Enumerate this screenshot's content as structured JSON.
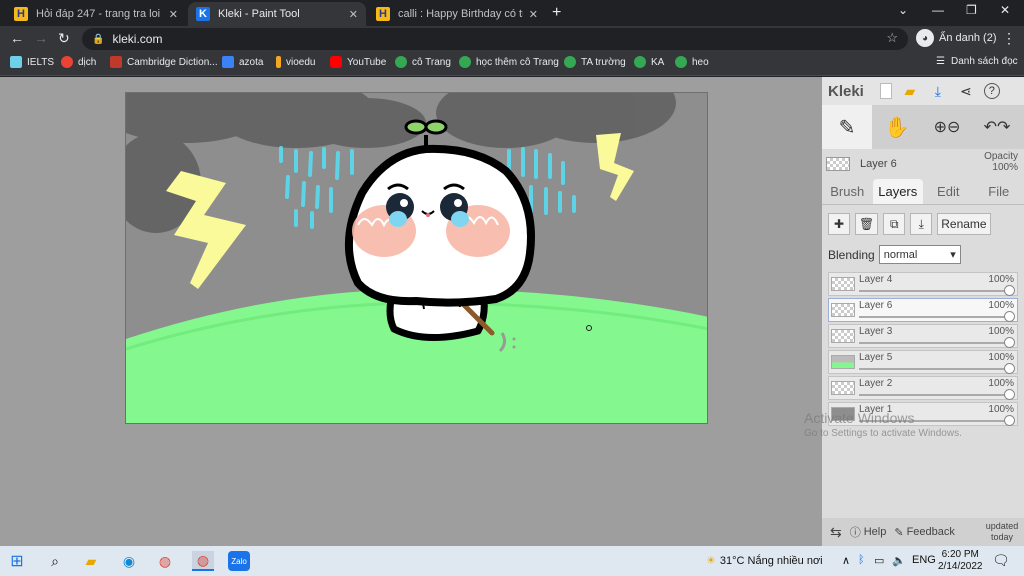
{
  "browser": {
    "tabs": [
      {
        "title": "Hỏi đáp 247 - trang tra loi",
        "favicon": "hoidap-h-icon",
        "active": false
      },
      {
        "title": "Kleki - Paint Tool",
        "favicon": "kleki-icon",
        "active": true
      },
      {
        "title": "calli : Happy Birthday có trang trí",
        "favicon": "hoidap-h-icon",
        "active": false
      }
    ],
    "new_tab": "+",
    "url": "kleki.com",
    "profile_label": "Ẩn danh (2)",
    "bookmarks": [
      {
        "label": "IELTS"
      },
      {
        "label": "dịch"
      },
      {
        "label": "Cambridge Diction..."
      },
      {
        "label": "azota"
      },
      {
        "label": "vioedu"
      },
      {
        "label": "YouTube"
      },
      {
        "label": "cô Trang"
      },
      {
        "label": "học thêm cô Trang"
      },
      {
        "label": "TA trường"
      },
      {
        "label": "KA"
      },
      {
        "label": "heo"
      }
    ],
    "reading_list": "Danh sách đọc"
  },
  "kleki": {
    "logo": "Kleki",
    "current_layer": "Layer 6",
    "opacity_label": "Opacity",
    "opacity_value": "100%",
    "tabs": [
      "Brush",
      "Layers",
      "Edit",
      "File"
    ],
    "active_tab": "Layers",
    "rename_label": "Rename",
    "blending_label": "Blending",
    "blending_value": "normal",
    "layers": [
      {
        "name": "Layer 4",
        "opacity": "100%",
        "active": false
      },
      {
        "name": "Layer 6",
        "opacity": "100%",
        "active": true
      },
      {
        "name": "Layer 3",
        "opacity": "100%",
        "active": false
      },
      {
        "name": "Layer 5",
        "opacity": "100%",
        "active": false
      },
      {
        "name": "Layer 2",
        "opacity": "100%",
        "active": false
      },
      {
        "name": "Layer 1",
        "opacity": "100%",
        "active": false
      }
    ],
    "footer": {
      "help": "Help",
      "feedback": "Feedback",
      "updated": "updated today"
    }
  },
  "watermark": {
    "line1": "Activate Windows",
    "line2": "Go to Settings to activate Windows."
  },
  "taskbar": {
    "weather": "31°C  Nắng nhiều nơi",
    "lang": "ENG",
    "time": "6:20 PM",
    "date": "2/14/2022"
  },
  "colors": {
    "sky_gray": "#8e8e8e",
    "grass": "#85f78f",
    "lightning": "#fafa9a",
    "rain": "#5ed3e6"
  }
}
